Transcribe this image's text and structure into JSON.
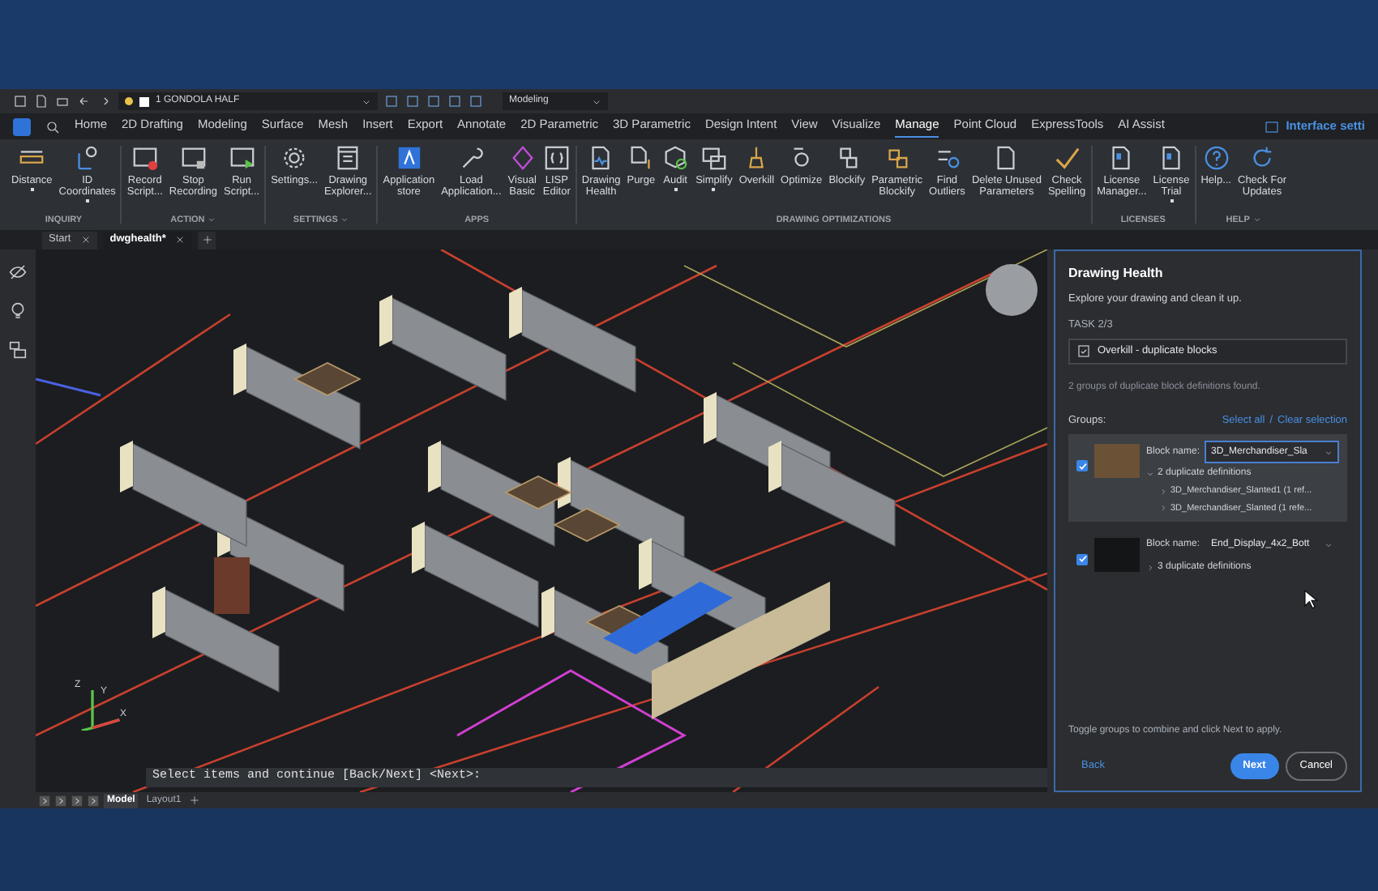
{
  "quick_access": {
    "layer": "1 GONDOLA HALF",
    "workspace": "Modeling"
  },
  "ribbon_tabs": [
    {
      "label": "Home",
      "selected": false
    },
    {
      "label": "2D Drafting",
      "selected": false
    },
    {
      "label": "Modeling",
      "selected": false
    },
    {
      "label": "Surface",
      "selected": false
    },
    {
      "label": "Mesh",
      "selected": false
    },
    {
      "label": "Insert",
      "selected": false
    },
    {
      "label": "Export",
      "selected": false
    },
    {
      "label": "Annotate",
      "selected": false
    },
    {
      "label": "2D Parametric",
      "selected": false
    },
    {
      "label": "3D Parametric",
      "selected": false
    },
    {
      "label": "Design Intent",
      "selected": false
    },
    {
      "label": "View",
      "selected": false
    },
    {
      "label": "Visualize",
      "selected": false
    },
    {
      "label": "Manage",
      "selected": true
    },
    {
      "label": "Point Cloud",
      "selected": false
    },
    {
      "label": "ExpressTools",
      "selected": false
    },
    {
      "label": "AI Assist",
      "selected": false
    }
  ],
  "interface_settings": "Interface setti",
  "ribbon_groups": [
    {
      "label": "INQUIRY",
      "has_menu": false,
      "tools": [
        {
          "label": "Distance",
          "has_dropdown": true
        },
        {
          "label": "ID\nCoordinates",
          "has_dropdown": true
        }
      ]
    },
    {
      "label": "ACTION",
      "has_menu": true,
      "tools": [
        {
          "label": "Record\nScript...",
          "has_dropdown": false
        },
        {
          "label": "Stop\nRecording",
          "has_dropdown": false
        },
        {
          "label": "Run\nScript...",
          "has_dropdown": false
        }
      ]
    },
    {
      "label": "SETTINGS",
      "has_menu": true,
      "tools": [
        {
          "label": "Settings...",
          "has_dropdown": false
        },
        {
          "label": "Drawing\nExplorer...",
          "has_dropdown": false
        }
      ]
    },
    {
      "label": "APPS",
      "has_menu": false,
      "tools": [
        {
          "label": "Application\nstore",
          "has_dropdown": false
        },
        {
          "label": "Load\nApplication...",
          "has_dropdown": false
        },
        {
          "label": "Visual\nBasic",
          "has_dropdown": false
        },
        {
          "label": "LISP\nEditor",
          "has_dropdown": false
        }
      ]
    },
    {
      "label": "DRAWING OPTIMIZATIONS",
      "has_menu": false,
      "tools": [
        {
          "label": "Drawing\nHealth",
          "has_dropdown": false
        },
        {
          "label": "Purge",
          "has_dropdown": false
        },
        {
          "label": "Audit",
          "has_dropdown": true
        },
        {
          "label": "Simplify",
          "has_dropdown": true
        },
        {
          "label": "Overkill",
          "has_dropdown": false
        },
        {
          "label": "Optimize",
          "has_dropdown": false
        },
        {
          "label": "Blockify",
          "has_dropdown": false
        },
        {
          "label": "Parametric\nBlockify",
          "has_dropdown": false
        },
        {
          "label": "Find\nOutliers",
          "has_dropdown": false
        },
        {
          "label": "Delete Unused\nParameters",
          "has_dropdown": false
        },
        {
          "label": "Check\nSpelling",
          "has_dropdown": false
        }
      ]
    },
    {
      "label": "LICENSES",
      "has_menu": false,
      "tools": [
        {
          "label": "License\nManager...",
          "has_dropdown": false
        },
        {
          "label": "License\nTrial",
          "has_dropdown": true
        }
      ]
    },
    {
      "label": "HELP",
      "has_menu": true,
      "tools": [
        {
          "label": "Help...",
          "has_dropdown": false
        },
        {
          "label": "Check For\nUpdates",
          "has_dropdown": false
        }
      ]
    }
  ],
  "document_tabs": [
    {
      "label": "Start",
      "selected": false
    },
    {
      "label": "dwghealth*",
      "selected": true
    }
  ],
  "axes": [
    "X",
    "Y",
    "Z"
  ],
  "command_line": "Select items and continue [Back/Next] <Next>:",
  "layout_tabs": [
    {
      "label": "Model",
      "selected": true
    },
    {
      "label": "Layout1",
      "selected": false
    }
  ],
  "drawing_health": {
    "title": "Drawing Health",
    "subtitle": "Explore your drawing and clean it up.",
    "task_label": "TASK 2/3",
    "task": "Overkill - duplicate blocks",
    "found": "2 groups of duplicate block definitions found.",
    "groups_label": "Groups:",
    "select_all": "Select all",
    "separator": "/",
    "clear_selection": "Clear selection",
    "groups": [
      {
        "checked": true,
        "selected": true,
        "block_name_label": "Block name:",
        "block_name": "3D_Merchandiser_Sla",
        "expanded": true,
        "summary": "2 duplicate definitions",
        "definitions": [
          "3D_Merchandiser_Slanted1 (1 ref...",
          "3D_Merchandiser_Slanted (1 refe..."
        ]
      },
      {
        "checked": true,
        "selected": false,
        "block_name_label": "Block name:",
        "block_name": "End_Display_4x2_Bott",
        "expanded": false,
        "summary": "3 duplicate definitions"
      }
    ],
    "hint": "Toggle groups to combine and click Next to apply.",
    "back": "Back",
    "next": "Next",
    "cancel": "Cancel"
  }
}
